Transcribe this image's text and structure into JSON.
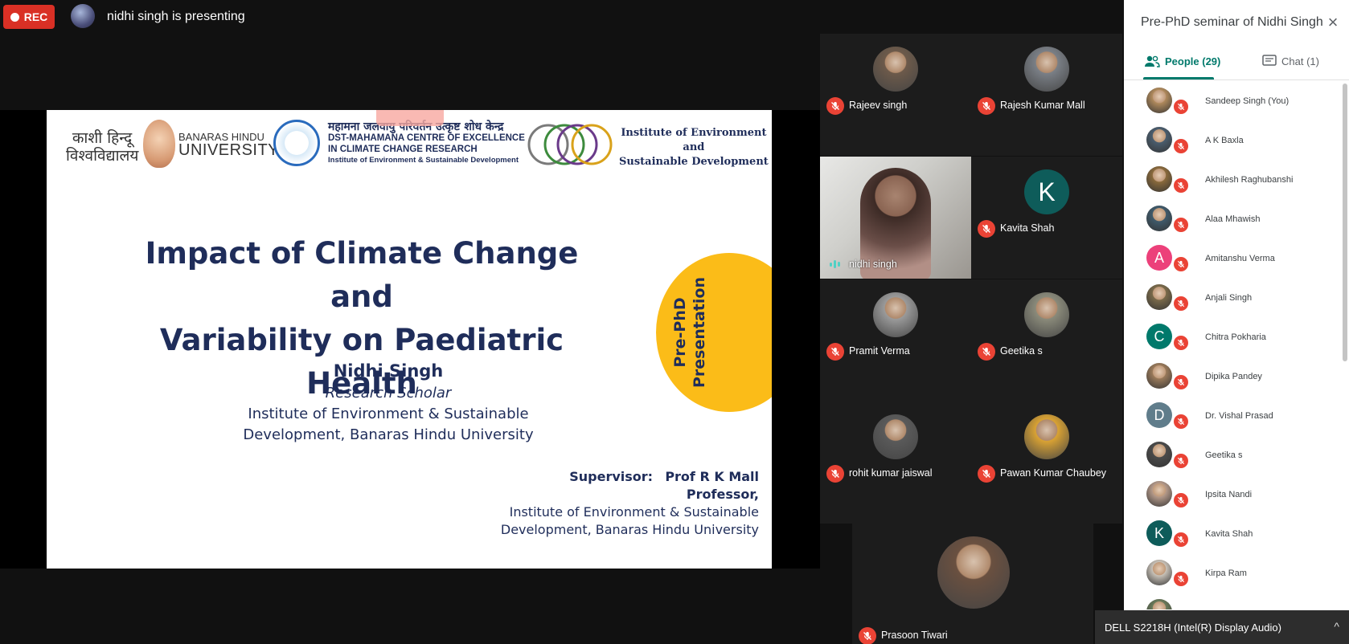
{
  "recording": {
    "label": "REC"
  },
  "presenter": {
    "text": "nidhi singh is presenting"
  },
  "slide": {
    "bhu_hindi": "काशी हिन्दू विश्वविद्यालय",
    "bhu_eng_line1": "BANARAS HINDU",
    "bhu_eng_line2": "UNIVERSITY",
    "dst_hindi": "महामना जलवायु परिवर्तन उत्कृष्ट शोध केन्द्र",
    "dst_line1": "DST-MAHAMANA CENTRE OF EXCELLENCE",
    "dst_line2": "IN CLIMATE CHANGE RESEARCH",
    "dst_line3": "Institute of Environment & Sustainable Development",
    "ied_line1": "Institute of Environment",
    "ied_line2": "and",
    "ied_line3": "Sustainable Development",
    "title_line1": "Impact of Climate Change and",
    "title_line2": "Variability on Paediatric Health",
    "badge_line1": "Pre-PhD",
    "badge_line2": "Presentation",
    "author_name": "Nidhi Singh",
    "author_role": "Research Scholar",
    "author_inst_line1": "Institute of Environment & Sustainable",
    "author_inst_line2": "Development, Banaras Hindu University",
    "supervisor_label": "Supervisor:",
    "supervisor_name": "Prof R K Mall",
    "supervisor_title": "Professor,",
    "supervisor_inst_line1": "Institute of Environment & Sustainable",
    "supervisor_inst_line2": "Development, Banaras Hindu University"
  },
  "tiles": [
    {
      "name": "Rajeev singh",
      "initial": ""
    },
    {
      "name": "Rajesh Kumar Mall",
      "initial": ""
    },
    {
      "name": "nidhi singh",
      "initial": ""
    },
    {
      "name": "Kavita Shah",
      "initial": "K"
    },
    {
      "name": "Pramit Verma",
      "initial": ""
    },
    {
      "name": "Geetika s",
      "initial": ""
    },
    {
      "name": "rohit kumar jaiswal",
      "initial": ""
    },
    {
      "name": "Pawan Kumar Chaubey",
      "initial": ""
    },
    {
      "name": "Prasoon Tiwari",
      "initial": ""
    }
  ],
  "panel": {
    "title": "Pre-PhD seminar of Nidhi Singh",
    "close_icon": "×",
    "tab_people": "People (29)",
    "tab_chat": "Chat (1)",
    "people": [
      {
        "name": "Sandeep Singh (You)",
        "initial": "",
        "color": "#b08a5c"
      },
      {
        "name": "A K Baxla",
        "initial": "",
        "color": "#4a5d6e"
      },
      {
        "name": "Akhilesh Raghubanshi",
        "initial": "",
        "color": "#8a6a3c"
      },
      {
        "name": "Alaa Mhawish",
        "initial": "",
        "color": "#3f5a6b"
      },
      {
        "name": "Amitanshu Verma",
        "initial": "A",
        "color": "#ec407a"
      },
      {
        "name": "Anjali Singh",
        "initial": "",
        "color": "#7a6a4a"
      },
      {
        "name": "Chitra Pokharia",
        "initial": "C",
        "color": "#00796b"
      },
      {
        "name": "Dipika Pandey",
        "initial": "",
        "color": "#9a7a5a"
      },
      {
        "name": "Dr. Vishal Prasad",
        "initial": "D",
        "color": "#607d8b"
      },
      {
        "name": "Geetika s",
        "initial": "",
        "color": "#4a4a4a"
      },
      {
        "name": "Ipsita Nandi",
        "initial": "",
        "color": "#b59a8a"
      },
      {
        "name": "Kavita Shah",
        "initial": "K",
        "color": "#0e5c5a"
      },
      {
        "name": "Kirpa Ram",
        "initial": "",
        "color": "#c9c2b8"
      },
      {
        "name": "",
        "initial": "",
        "color": "#6a7a5a"
      }
    ]
  },
  "audio": {
    "label": "DELL S2218H (Intel(R) Display Audio)",
    "caret": "^"
  }
}
